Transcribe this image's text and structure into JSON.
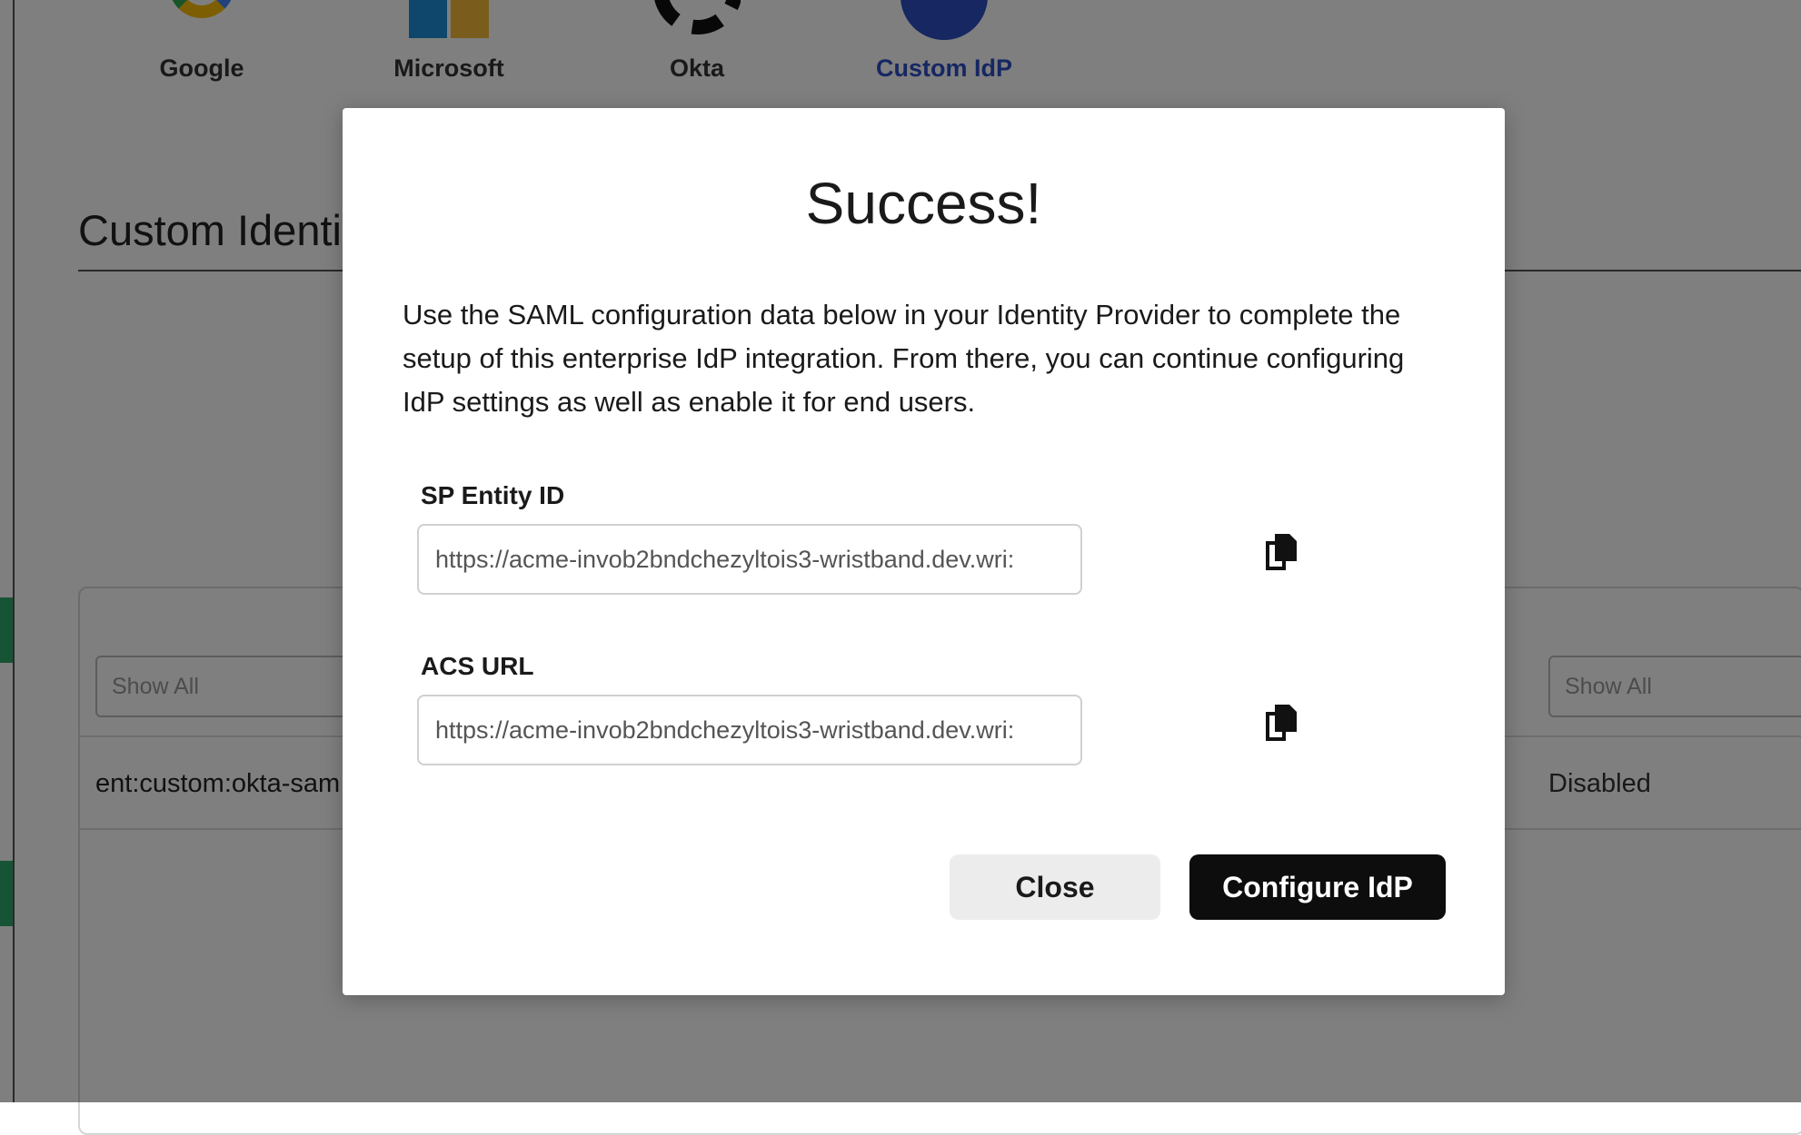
{
  "providers": [
    {
      "label": "Google",
      "icon": "google-logo-icon"
    },
    {
      "label": "Microsoft",
      "icon": "microsoft-logo-icon"
    },
    {
      "label": "Okta",
      "icon": "okta-logo-icon"
    },
    {
      "label": "Custom IdP",
      "icon": "custom-idp-logo-icon",
      "active": true
    }
  ],
  "section": {
    "title": "Custom Identi"
  },
  "table": {
    "filter_left_placeholder": "Show All",
    "filter_right_placeholder": "Show All",
    "row": {
      "name": "ent:custom:okta-sam",
      "status": "Disabled"
    }
  },
  "modal": {
    "title": "Success!",
    "description": "Use the SAML configuration data below in your Identity Provider to complete the setup of this enterprise IdP integration. From there, you can continue configuring IdP settings as well as enable it for end users.",
    "fields": [
      {
        "label": "SP Entity ID",
        "value": "https://acme-invob2bndchezyltois3-wristband.dev.wri:"
      },
      {
        "label": "ACS URL",
        "value": "https://acme-invob2bndchezyltois3-wristband.dev.wri:"
      }
    ],
    "close_label": "Close",
    "configure_label": "Configure IdP"
  },
  "colors": {
    "accent": "#2d4fc4",
    "primary_button": "#0d0d0d",
    "secondary_button": "#ececec",
    "rail_mark": "#2ea86a"
  },
  "icons": {
    "copy": "copy-icon"
  }
}
